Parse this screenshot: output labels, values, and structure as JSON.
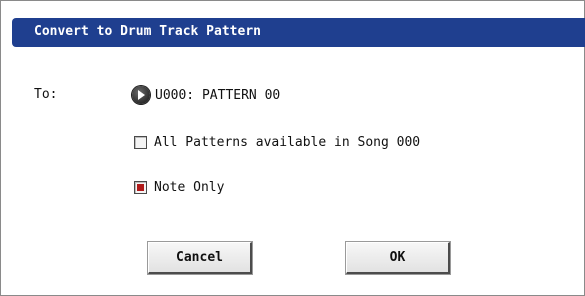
{
  "dialog": {
    "title": "Convert to Drum Track Pattern",
    "to_label": "To:",
    "pattern_value": "U000: PATTERN 00",
    "all_patterns": {
      "label": "All Patterns available in Song 000",
      "checked": false
    },
    "note_only": {
      "label": "Note Only",
      "checked": true
    },
    "cancel_label": "Cancel",
    "ok_label": "OK"
  },
  "colors": {
    "titlebar": "#1f3f8f",
    "checkbox_fill": "#b01a1a"
  },
  "icons": {
    "pattern_select": "right-arrow-circle-icon"
  }
}
